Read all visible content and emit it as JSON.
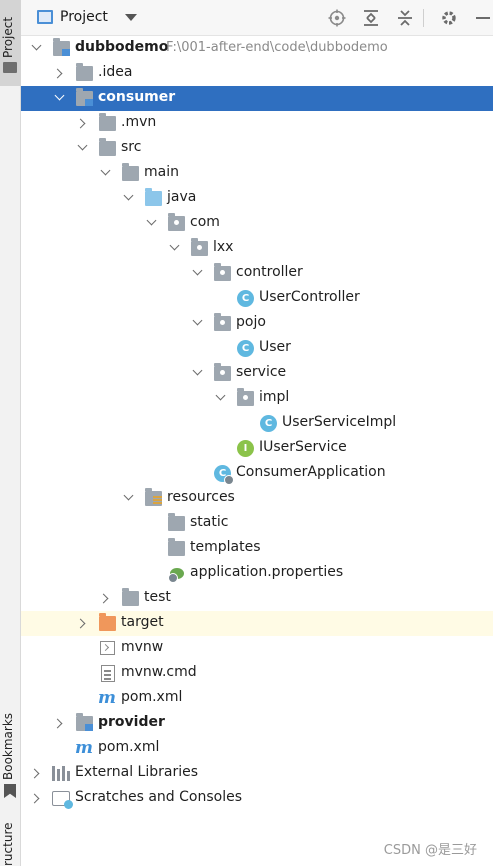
{
  "side_strip": {
    "project_tab": "Project",
    "bookmarks_tab": "Bookmarks",
    "structure_tab": "ructure"
  },
  "header": {
    "title": "Project",
    "icons": [
      "locate-icon",
      "expand-all-icon",
      "collapse-all-icon",
      "gear-icon",
      "hide-icon"
    ]
  },
  "tree": {
    "root": {
      "label": "dubbodemo",
      "path": "F:\\001-after-end\\code\\dubbodemo"
    },
    "idea": ".idea",
    "consumer": "consumer",
    "mvn": ".mvn",
    "src": "src",
    "main": "main",
    "java": "java",
    "com": "com",
    "lxx": "lxx",
    "controller": "controller",
    "user_controller": "UserController",
    "pojo": "pojo",
    "user": "User",
    "service": "service",
    "impl": "impl",
    "user_service_impl": "UserServiceImpl",
    "iuser_service": "IUserService",
    "consumer_application": "ConsumerApplication",
    "resources": "resources",
    "static": "static",
    "templates": "templates",
    "application_properties": "application.properties",
    "test": "test",
    "target": "target",
    "mvnw": "mvnw",
    "mvnw_cmd": "mvnw.cmd",
    "consumer_pom": "pom.xml",
    "provider": "provider",
    "root_pom": "pom.xml",
    "external_libraries": "External Libraries",
    "scratches": "Scratches and Consoles"
  },
  "glyphs": {
    "class": "C",
    "interface": "I",
    "maven": "m"
  },
  "colors": {
    "selection": "#2f6fc0",
    "excluded_row": "#fffbe5",
    "source_folder": "#8cc6ea",
    "excluded_folder": "#f0975b"
  },
  "watermark": "CSDN @是三好"
}
